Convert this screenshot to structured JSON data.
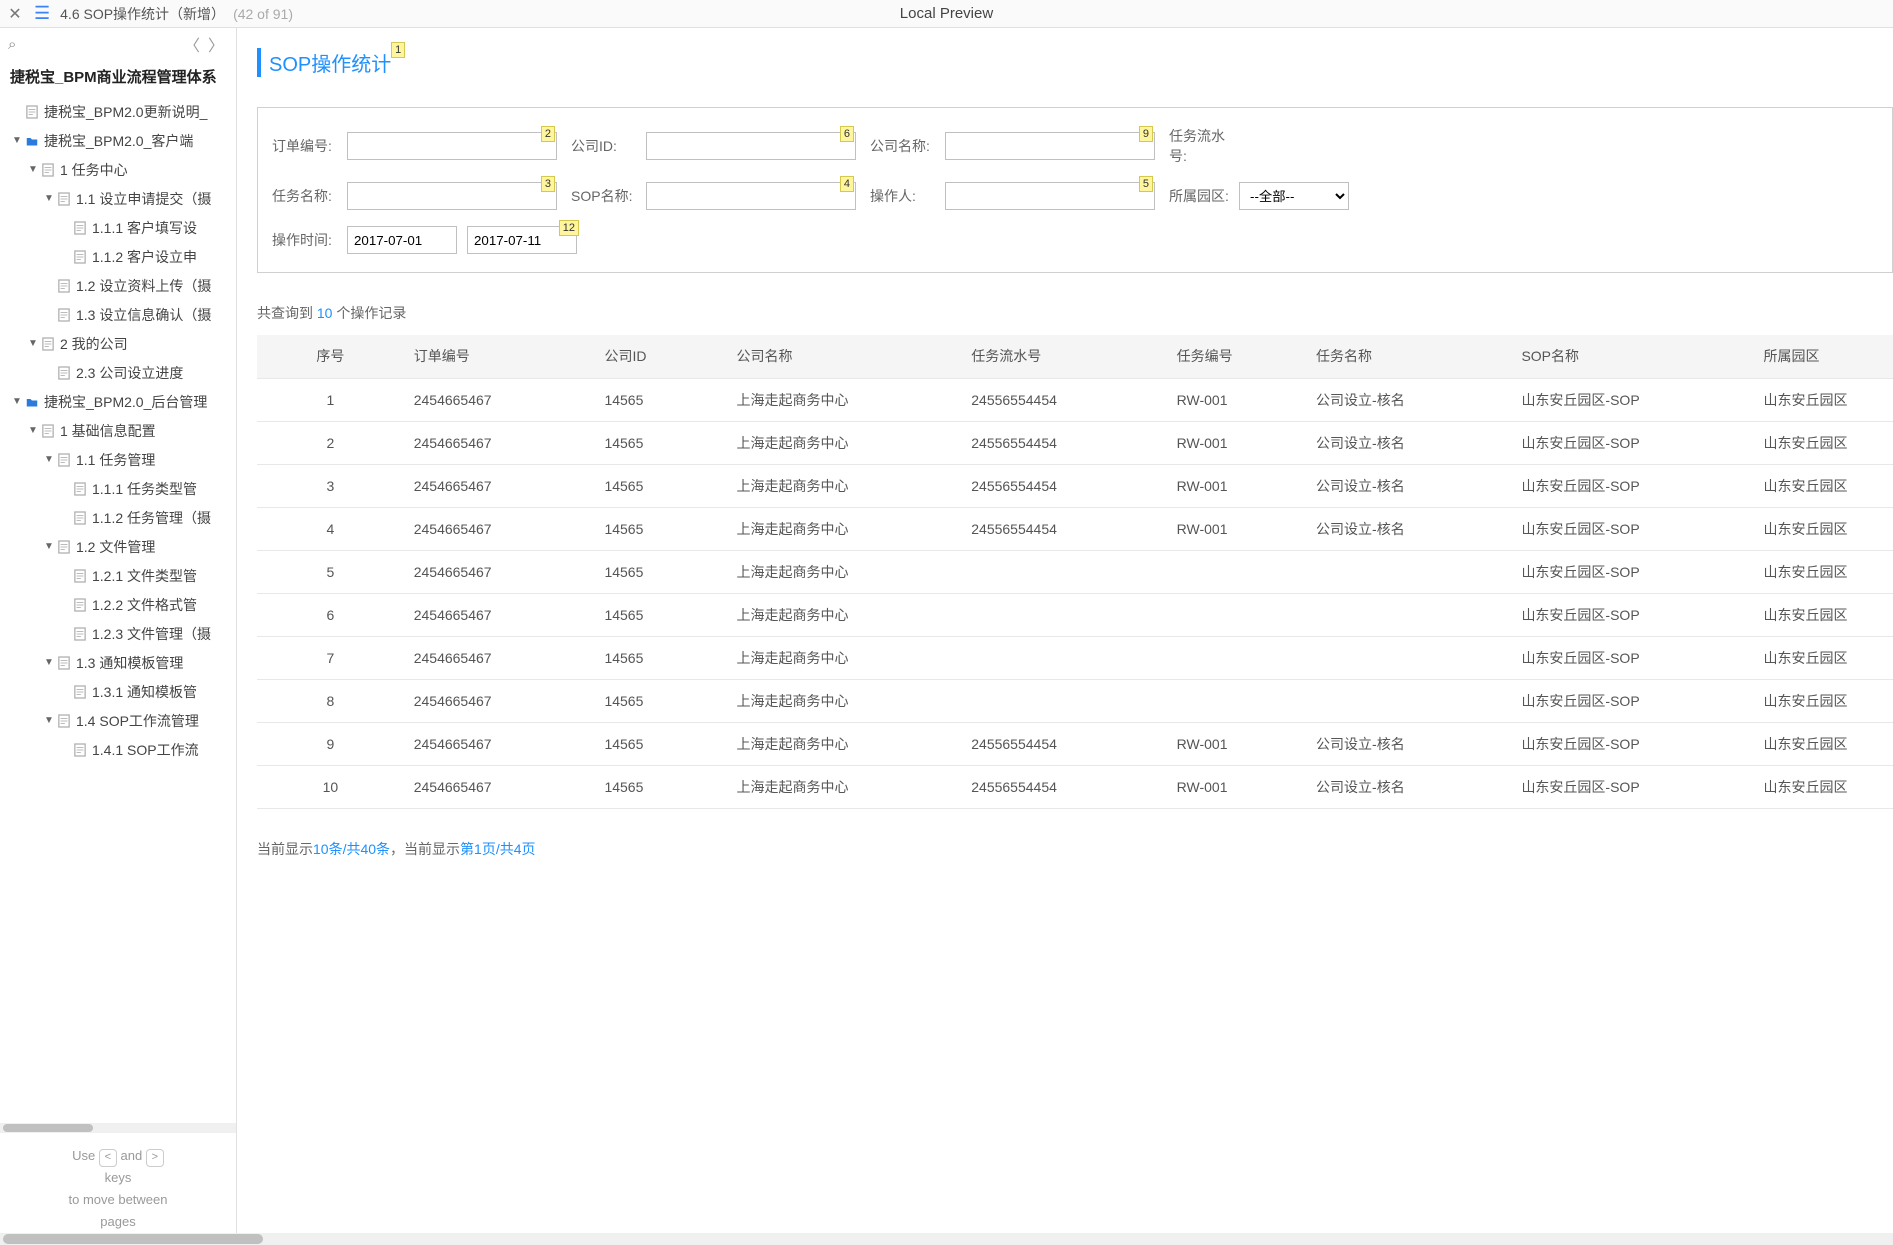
{
  "topbar": {
    "breadcrumb": "4.6 SOP操作统计（新增）",
    "counter": "(42 of 91)",
    "local_preview": "Local Preview"
  },
  "sidebar": {
    "title": "捷税宝_BPM商业流程管理体系",
    "help_use": "Use",
    "help_and": "and",
    "help_keys": "keys",
    "help_move": "to move between",
    "help_pages": "pages",
    "nodes": [
      {
        "lvl": "l1",
        "chev": "",
        "ic": "doc",
        "label": "捷税宝_BPM2.0更新说明_"
      },
      {
        "lvl": "l1",
        "chev": "▼",
        "ic": "folder",
        "label": "捷税宝_BPM2.0_客户端"
      },
      {
        "lvl": "l2",
        "chev": "▼",
        "ic": "doc",
        "label": "1 任务中心"
      },
      {
        "lvl": "l3",
        "chev": "▼",
        "ic": "doc",
        "label": "1.1 设立申请提交（摄"
      },
      {
        "lvl": "l4",
        "chev": "",
        "ic": "doc",
        "label": "1.1.1 客户填写设"
      },
      {
        "lvl": "l4",
        "chev": "",
        "ic": "doc",
        "label": "1.1.2 客户设立申"
      },
      {
        "lvl": "l3",
        "chev": "",
        "ic": "doc",
        "label": "1.2 设立资料上传（摄"
      },
      {
        "lvl": "l3",
        "chev": "",
        "ic": "doc",
        "label": "1.3 设立信息确认（摄"
      },
      {
        "lvl": "l2",
        "chev": "▼",
        "ic": "doc",
        "label": "2 我的公司"
      },
      {
        "lvl": "l3",
        "chev": "",
        "ic": "doc",
        "label": "2.3 公司设立进度"
      },
      {
        "lvl": "l1",
        "chev": "▼",
        "ic": "folder",
        "label": "捷税宝_BPM2.0_后台管理"
      },
      {
        "lvl": "l2",
        "chev": "▼",
        "ic": "doc",
        "label": "1 基础信息配置"
      },
      {
        "lvl": "l3",
        "chev": "▼",
        "ic": "doc",
        "label": "1.1 任务管理"
      },
      {
        "lvl": "l4",
        "chev": "",
        "ic": "doc",
        "label": "1.1.1 任务类型管"
      },
      {
        "lvl": "l4",
        "chev": "",
        "ic": "doc",
        "label": "1.1.2 任务管理（摄"
      },
      {
        "lvl": "l3",
        "chev": "▼",
        "ic": "doc",
        "label": "1.2 文件管理"
      },
      {
        "lvl": "l4",
        "chev": "",
        "ic": "doc",
        "label": "1.2.1 文件类型管"
      },
      {
        "lvl": "l4",
        "chev": "",
        "ic": "doc",
        "label": "1.2.2 文件格式管"
      },
      {
        "lvl": "l4",
        "chev": "",
        "ic": "doc",
        "label": "1.2.3 文件管理（摄"
      },
      {
        "lvl": "l3",
        "chev": "▼",
        "ic": "doc",
        "label": "1.3 通知模板管理"
      },
      {
        "lvl": "l4",
        "chev": "",
        "ic": "doc",
        "label": "1.3.1 通知模板管"
      },
      {
        "lvl": "l3",
        "chev": "▼",
        "ic": "doc",
        "label": "1.4 SOP工作流管理"
      },
      {
        "lvl": "l4",
        "chev": "",
        "ic": "doc",
        "label": "1.4.1 SOP工作流"
      }
    ]
  },
  "page": {
    "title": "SOP操作统计",
    "badges": {
      "title": "1",
      "f_order": "2",
      "f_company_id": "6",
      "f_company_name": "9",
      "f_task_name": "3",
      "f_sop_name": "4",
      "f_operator": "5",
      "f_op_time": "12"
    },
    "form": {
      "order_no_label": "订单编号:",
      "company_id_label": "公司ID:",
      "company_name_label": "公司名称:",
      "task_flow_label": "任务流水号:",
      "task_name_label": "任务名称:",
      "sop_name_label": "SOP名称:",
      "operator_label": "操作人:",
      "park_label": "所属园区:",
      "park_value": "--全部--",
      "op_time_label": "操作时间:",
      "date_from": "2017-07-01",
      "date_to": "2017-07-11"
    },
    "result_prefix": "共查询到 ",
    "result_count": "10",
    "result_suffix": " 个操作记录",
    "columns": {
      "seq": "序号",
      "order": "订单编号",
      "cid": "公司ID",
      "cname": "公司名称",
      "flow": "任务流水号",
      "tno": "任务编号",
      "tname": "任务名称",
      "sop": "SOP名称",
      "park": "所属园区"
    },
    "rows": [
      {
        "seq": "1",
        "order": "2454665467",
        "cid": "14565",
        "cname": "上海走起商务中心",
        "flow": "24556554454",
        "tno": "RW-001",
        "tname": "公司设立-核名",
        "sop": "山东安丘园区-SOP",
        "park": "山东安丘园区"
      },
      {
        "seq": "2",
        "order": "2454665467",
        "cid": "14565",
        "cname": "上海走起商务中心",
        "flow": "24556554454",
        "tno": "RW-001",
        "tname": "公司设立-核名",
        "sop": "山东安丘园区-SOP",
        "park": "山东安丘园区"
      },
      {
        "seq": "3",
        "order": "2454665467",
        "cid": "14565",
        "cname": "上海走起商务中心",
        "flow": "24556554454",
        "tno": "RW-001",
        "tname": "公司设立-核名",
        "sop": "山东安丘园区-SOP",
        "park": "山东安丘园区"
      },
      {
        "seq": "4",
        "order": "2454665467",
        "cid": "14565",
        "cname": "上海走起商务中心",
        "flow": "24556554454",
        "tno": "RW-001",
        "tname": "公司设立-核名",
        "sop": "山东安丘园区-SOP",
        "park": "山东安丘园区"
      },
      {
        "seq": "5",
        "order": "2454665467",
        "cid": "14565",
        "cname": "上海走起商务中心",
        "flow": "",
        "tno": "",
        "tname": "",
        "sop": "山东安丘园区-SOP",
        "park": "山东安丘园区"
      },
      {
        "seq": "6",
        "order": "2454665467",
        "cid": "14565",
        "cname": "上海走起商务中心",
        "flow": "",
        "tno": "",
        "tname": "",
        "sop": "山东安丘园区-SOP",
        "park": "山东安丘园区"
      },
      {
        "seq": "7",
        "order": "2454665467",
        "cid": "14565",
        "cname": "上海走起商务中心",
        "flow": "",
        "tno": "",
        "tname": "",
        "sop": "山东安丘园区-SOP",
        "park": "山东安丘园区"
      },
      {
        "seq": "8",
        "order": "2454665467",
        "cid": "14565",
        "cname": "上海走起商务中心",
        "flow": "",
        "tno": "",
        "tname": "",
        "sop": "山东安丘园区-SOP",
        "park": "山东安丘园区"
      },
      {
        "seq": "9",
        "order": "2454665467",
        "cid": "14565",
        "cname": "上海走起商务中心",
        "flow": "24556554454",
        "tno": "RW-001",
        "tname": "公司设立-核名",
        "sop": "山东安丘园区-SOP",
        "park": "山东安丘园区"
      },
      {
        "seq": "10",
        "order": "2454665467",
        "cid": "14565",
        "cname": "上海走起商务中心",
        "flow": "24556554454",
        "tno": "RW-001",
        "tname": "公司设立-核名",
        "sop": "山东安丘园区-SOP",
        "park": "山东安丘园区"
      }
    ],
    "paging": {
      "p1": "当前显示",
      "p2": "10条/共40条",
      "p3": "，当前显示",
      "p4": "第1页/共4页"
    }
  }
}
